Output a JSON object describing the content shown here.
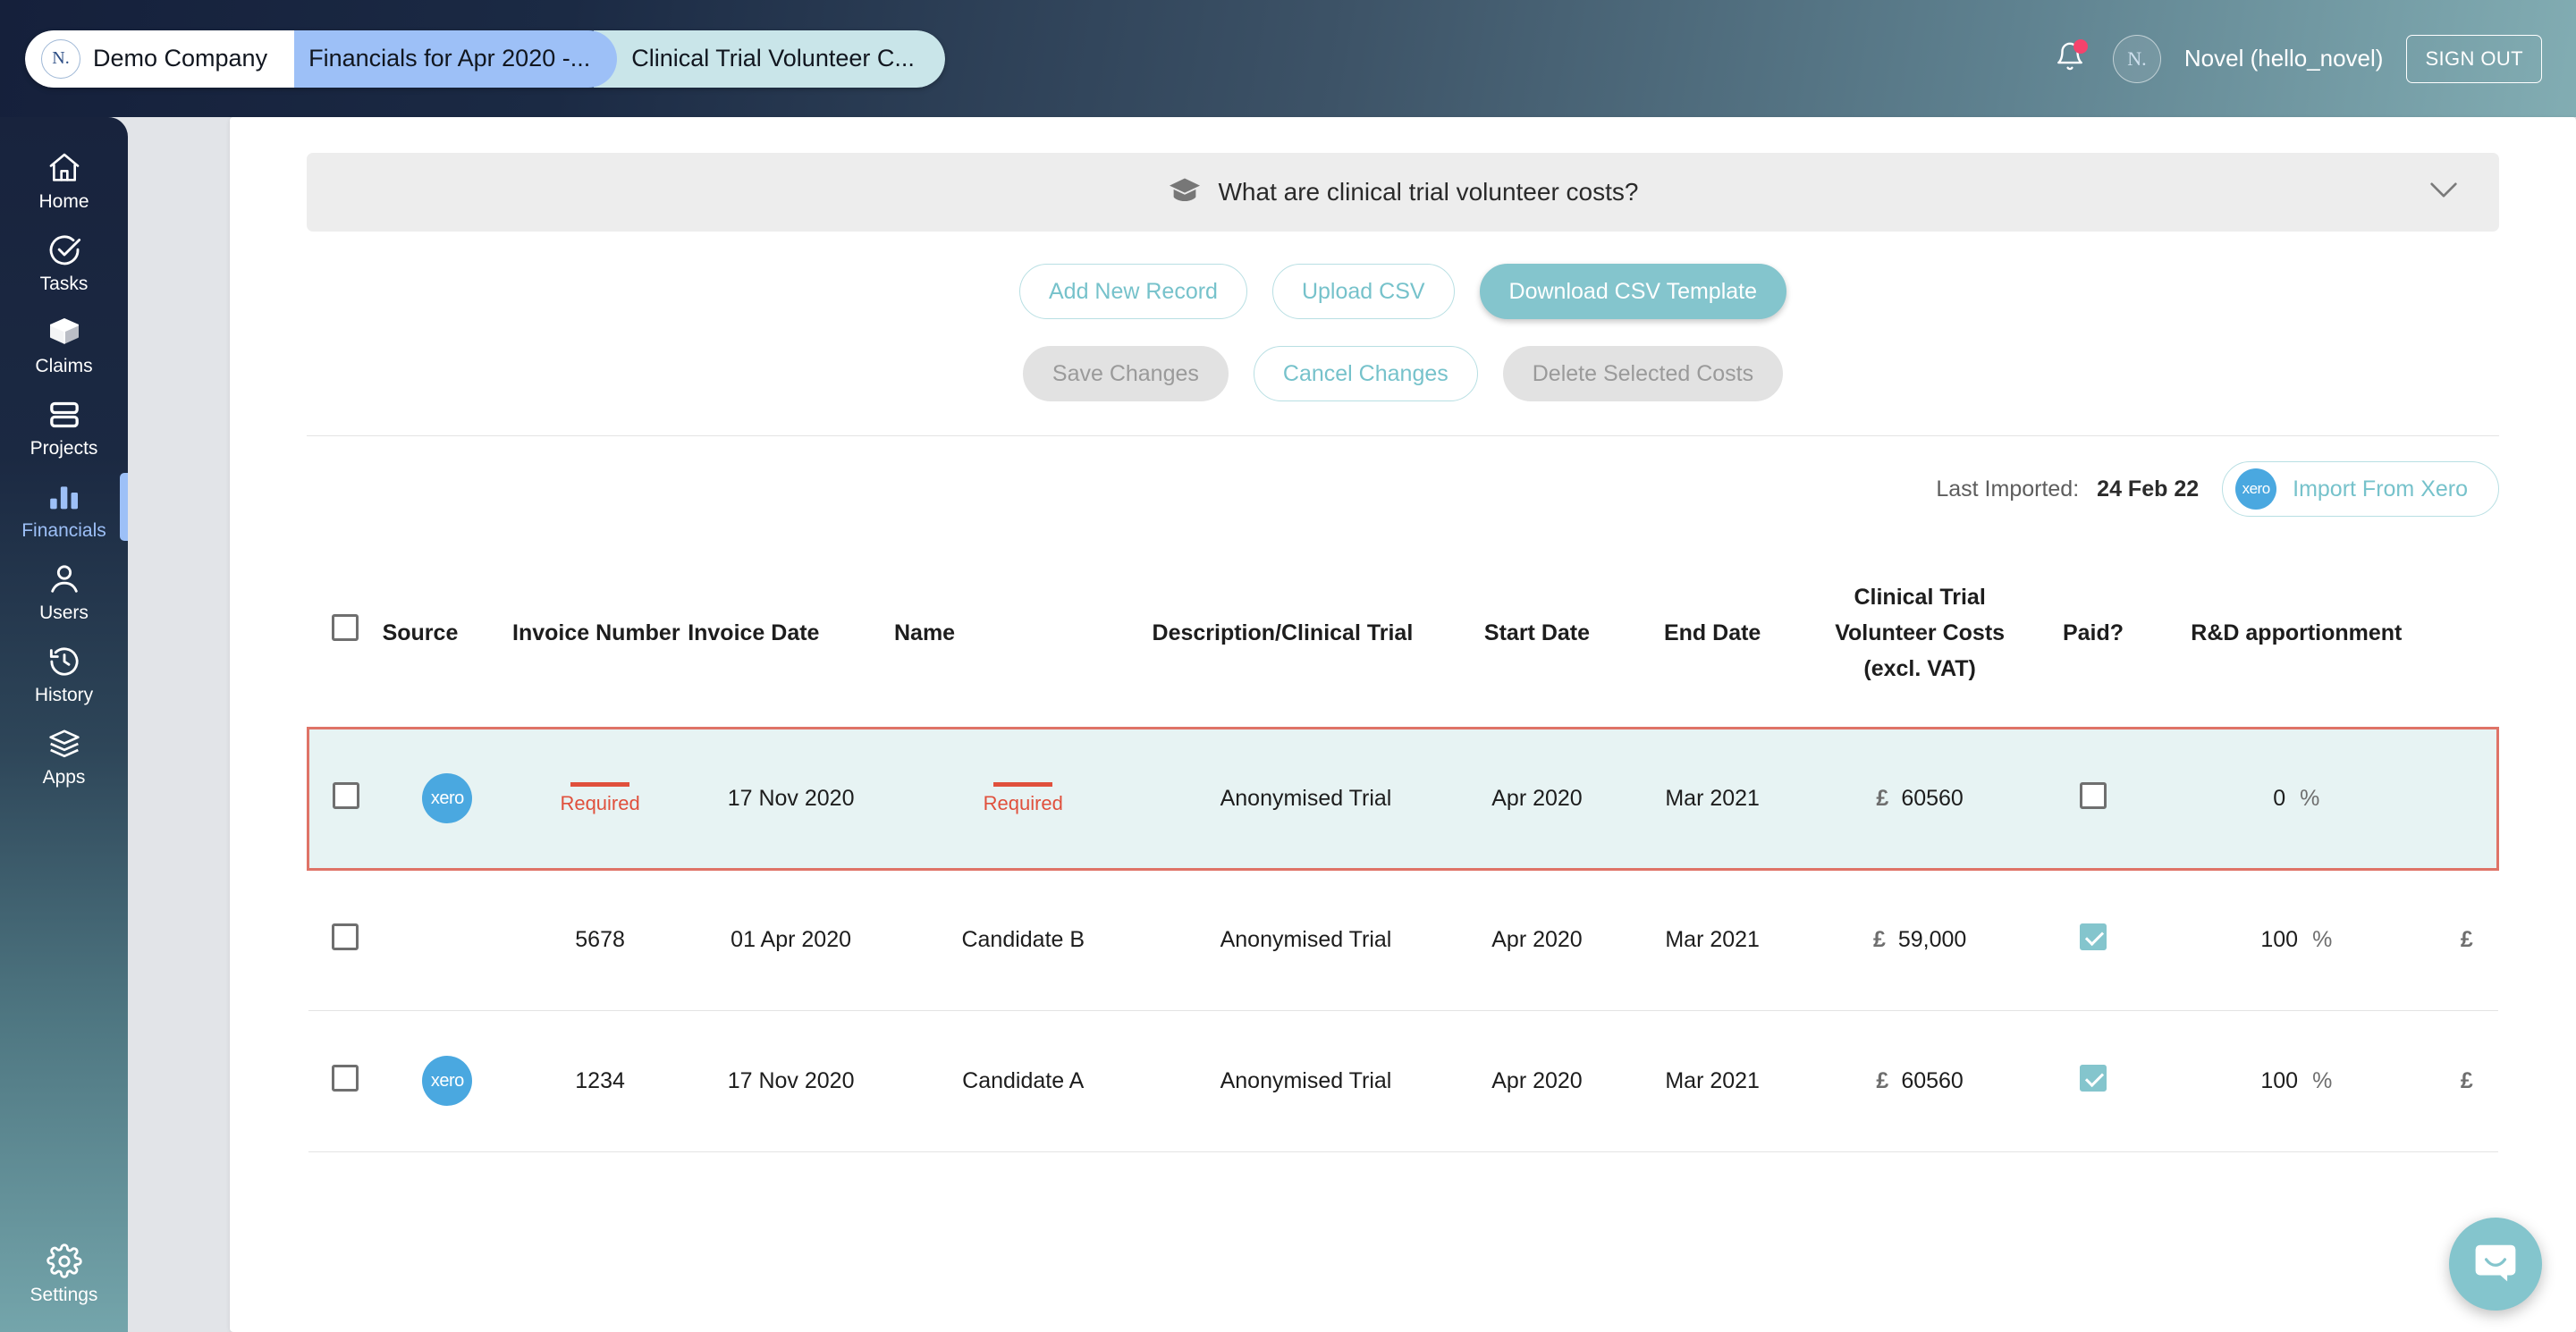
{
  "header": {
    "breadcrumbs": [
      {
        "label": "Demo Company",
        "logo": "N."
      },
      {
        "label": "Financials for Apr 2020 -..."
      },
      {
        "label": "Clinical Trial Volunteer C..."
      }
    ],
    "bell_icon": "bell-icon",
    "avatar_initials": "N.",
    "user_label": "Novel (hello_novel)",
    "sign_out_label": "SIGN OUT",
    "accent_navy": "#15203b",
    "accent_teal": "#82adb3"
  },
  "sidebar": {
    "items": [
      {
        "label": "Home",
        "icon": "home-icon",
        "active": false
      },
      {
        "label": "Tasks",
        "icon": "check-circle-icon",
        "active": false
      },
      {
        "label": "Claims",
        "icon": "box-icon",
        "active": false
      },
      {
        "label": "Projects",
        "icon": "layers-rows-icon",
        "active": false
      },
      {
        "label": "Financials",
        "icon": "bar-chart-icon",
        "active": true
      },
      {
        "label": "Users",
        "icon": "user-icon",
        "active": false
      },
      {
        "label": "History",
        "icon": "history-icon",
        "active": false
      },
      {
        "label": "Apps",
        "icon": "stack-icon",
        "active": false
      }
    ],
    "footer": {
      "label": "Settings",
      "icon": "gear-icon"
    }
  },
  "help_banner": {
    "icon": "graduation-cap-icon",
    "question": "What are clinical trial volunteer costs?",
    "chevron": "chevron-down-icon"
  },
  "actions": {
    "primary_row": [
      {
        "label": "Add New Record",
        "style": "outline"
      },
      {
        "label": "Upload CSV",
        "style": "outline"
      },
      {
        "label": "Download CSV Template",
        "style": "filled"
      }
    ],
    "secondary_row": [
      {
        "label": "Save Changes",
        "style": "disabled"
      },
      {
        "label": "Cancel Changes",
        "style": "outline"
      },
      {
        "label": "Delete Selected Costs",
        "style": "disabled"
      }
    ]
  },
  "import": {
    "last_imported_label": "Last Imported:",
    "last_imported_date": "24 Feb 22",
    "xero_button_label": "Import From Xero",
    "xero_logo_text": "xero"
  },
  "table": {
    "headers": [
      "",
      "Source",
      "Invoice Number",
      "Invoice Date",
      "Name",
      "Description/Clinical Trial",
      "Start Date",
      "End Date",
      "Clinical Trial Volunteer Costs (excl. VAT)",
      "Paid?",
      "R&D apportionment",
      ""
    ],
    "select_all_checked": false,
    "rows": [
      {
        "highlighted": true,
        "selected": false,
        "source": "xero",
        "invoice_number": "Required",
        "invoice_number_required": true,
        "invoice_date": "17 Nov 2020",
        "name": "Required",
        "name_required": true,
        "description": "Anonymised Trial",
        "start_date": "Apr 2020",
        "end_date": "Mar 2021",
        "currency": "£",
        "cost": "60560",
        "paid": false,
        "apportionment": "0",
        "percent_symbol": "%",
        "trailing_currency": ""
      },
      {
        "highlighted": false,
        "selected": false,
        "source": "",
        "invoice_number": "5678",
        "invoice_number_required": false,
        "invoice_date": "01 Apr 2020",
        "name": "Candidate B",
        "name_required": false,
        "description": "Anonymised Trial",
        "start_date": "Apr 2020",
        "end_date": "Mar 2021",
        "currency": "£",
        "cost": "59,000",
        "paid": true,
        "apportionment": "100",
        "percent_symbol": "%",
        "trailing_currency": "£"
      },
      {
        "highlighted": false,
        "selected": false,
        "source": "xero",
        "invoice_number": "1234",
        "invoice_number_required": false,
        "invoice_date": "17 Nov 2020",
        "name": "Candidate A",
        "name_required": false,
        "description": "Anonymised Trial",
        "start_date": "Apr 2020",
        "end_date": "Mar 2021",
        "currency": "£",
        "cost": "60560",
        "paid": true,
        "apportionment": "100",
        "percent_symbol": "%",
        "trailing_currency": "£"
      }
    ],
    "required_label": "Required"
  },
  "chat": {
    "icon": "chat-bubble-icon"
  }
}
